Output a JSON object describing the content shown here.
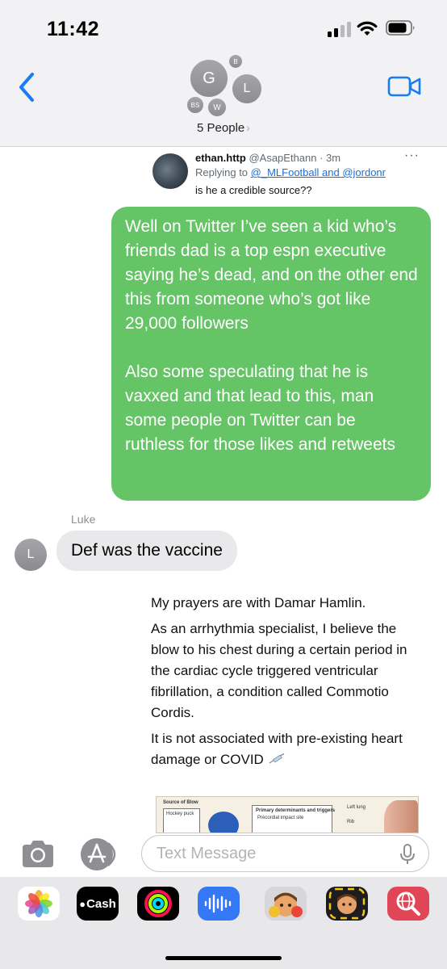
{
  "status_bar": {
    "time": "11:42"
  },
  "header": {
    "group_title": "5 People",
    "avatars": {
      "main": "G",
      "right": "L",
      "top": "B",
      "left_small": "BS",
      "bottom": "W"
    },
    "back_icon": "chevron-left-icon",
    "video_icon": "video-camera-icon"
  },
  "tweet": {
    "display_name": "ethan.http",
    "handle_time": "@AsapEthann · 3m",
    "more": "···",
    "replying_prefix": "Replying to",
    "replying_to": "@_MLFootball and @jordonr",
    "text": "is he a credible source??"
  },
  "messages": {
    "sent_paragraph_1": "Well on Twitter I’ve seen a kid who’s friends dad is a top espn executive saying he’s dead, and on the other end this from someone who’s got like 29,000 followers",
    "sent_paragraph_2": "Also some speculating that he is vaxxed and that lead to this, man some people on Twitter can be ruthless for those likes and retweets",
    "sender_name": "Luke",
    "sender_initial": "L",
    "received_text": "Def was the vaccine"
  },
  "shared_post": {
    "paragraph_1": "My prayers are with Damar Hamlin.",
    "paragraph_2": "As an arrhythmia specialist, I believe the blow to his chest during a certain period in the cardiac cycle triggered ventricular fibrillation, a condition called Commotio Cordis.",
    "paragraph_3": "It is not associated with pre-existing heart damage or COVID",
    "diagram": {
      "source_label": "Source of Blow",
      "puck_label": "Hockey puck",
      "box_title": "Primary determinants and triggers",
      "box_line": "Precordial impact site",
      "lung_label": "Left lung",
      "rib_label": "Rib"
    }
  },
  "input": {
    "placeholder": "Text Message"
  },
  "app_drawer": {
    "apps": [
      "photos-icon",
      "cash-app-icon",
      "activity-icon",
      "audio-message-icon",
      "memoji-icon",
      "memoji-stickers-icon",
      "web-search-icon"
    ],
    "cash_label": "Cash"
  },
  "colors": {
    "sent_bubble": "#65c466",
    "received_bubble": "#e9e9eb",
    "ios_blue": "#1a7cf5"
  }
}
